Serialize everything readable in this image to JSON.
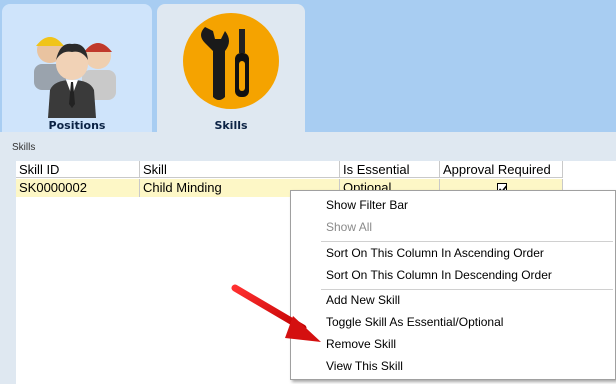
{
  "tabs": [
    {
      "label": "Positions",
      "icon": "people-icon"
    },
    {
      "label": "Skills",
      "icon": "tools-icon"
    }
  ],
  "section": {
    "label": "Skills"
  },
  "grid": {
    "columns": [
      "Skill ID",
      "Skill",
      "Is Essential",
      "Approval Required"
    ],
    "rows": [
      {
        "skill_id": "SK0000002",
        "skill": "Child Minding",
        "is_essential": "Optional",
        "approval_required": true
      }
    ]
  },
  "context_menu": {
    "items": [
      {
        "label": "Show Filter Bar",
        "enabled": true
      },
      {
        "label": "Show All",
        "enabled": false
      },
      {
        "label": "Sort On This Column In Ascending Order",
        "enabled": true
      },
      {
        "label": "Sort On This Column In Descending Order",
        "enabled": true
      },
      {
        "label": "Add New Skill",
        "enabled": true
      },
      {
        "label": "Toggle Skill As Essential/Optional",
        "enabled": true
      },
      {
        "label": "Remove Skill",
        "enabled": true
      },
      {
        "label": "View This Skill",
        "enabled": true
      }
    ]
  },
  "colors": {
    "header_bg": "#a8cdf2",
    "selected_row": "#fdf7c6",
    "skills_icon": "#f5a300",
    "arrow": "#e01010"
  }
}
